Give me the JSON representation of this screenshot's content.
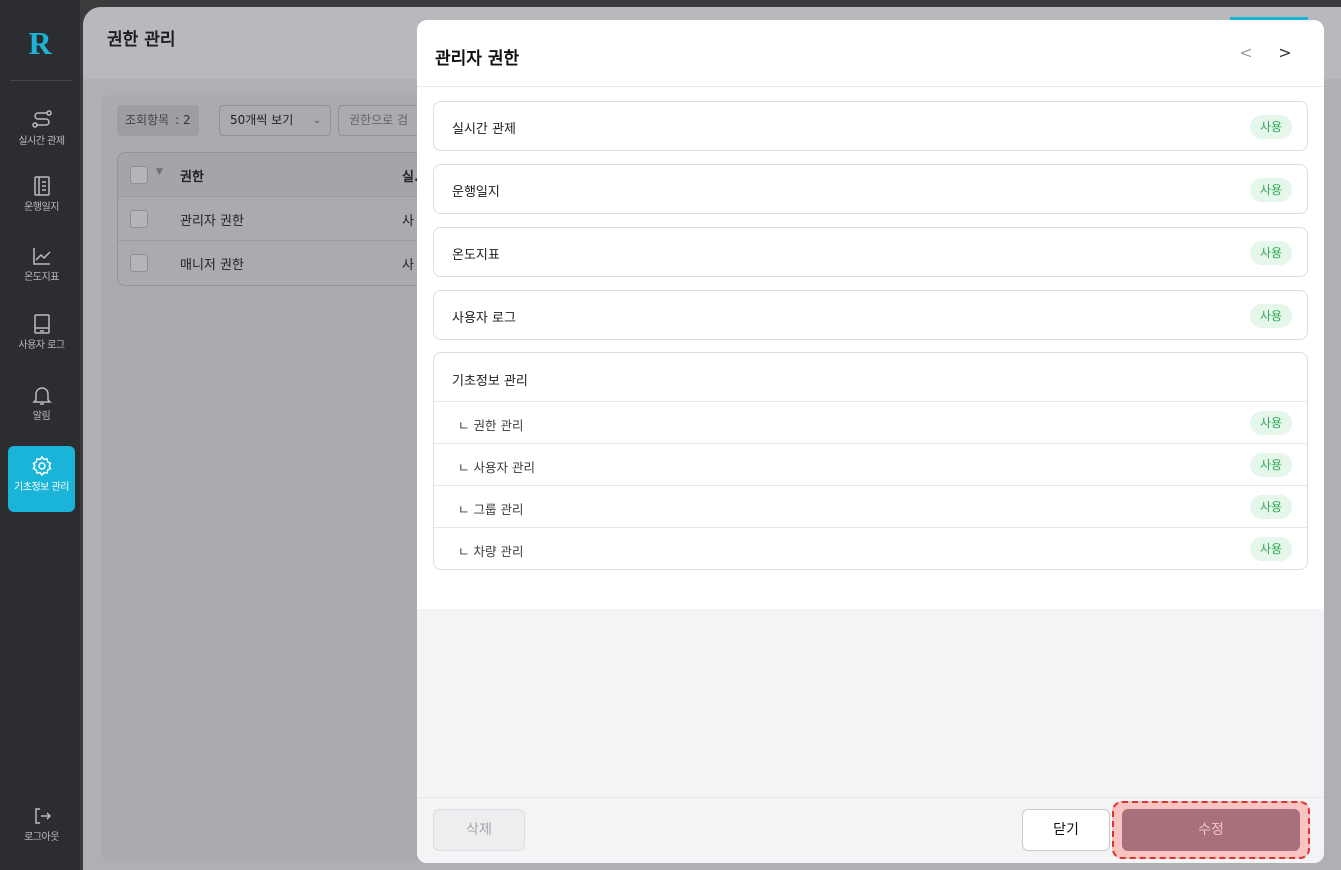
{
  "app": {
    "logo_text": "R",
    "accent_color": "#19b4d8"
  },
  "sidebar": {
    "items": [
      {
        "label": "실시간 관제",
        "icon": "route-icon"
      },
      {
        "label": "운행일지",
        "icon": "document-icon"
      },
      {
        "label": "온도지표",
        "icon": "line-chart-icon"
      },
      {
        "label": "사용자 로그",
        "icon": "monitor-icon"
      },
      {
        "label": "알림",
        "icon": "bell-icon"
      },
      {
        "label": "기초정보 관리",
        "icon": "gear-icon",
        "active": true
      }
    ],
    "logout_label": "로그아웃"
  },
  "page": {
    "title": "권한 관리",
    "count_label": "조회항목",
    "count_value": ": 2",
    "page_size": "50개씩 보기",
    "search_placeholder": "권한으로 검",
    "table": {
      "headers": [
        "권한",
        "실."
      ],
      "rows": [
        {
          "name": "관리자 권한",
          "col2": "사"
        },
        {
          "name": "매니저 권한",
          "col2": "사"
        }
      ]
    }
  },
  "modal": {
    "title": "관리자 권한",
    "prev_icon": "<",
    "next_icon": ">",
    "permissions": [
      {
        "label": "실시간 관제",
        "status": "사용"
      },
      {
        "label": "운행일지",
        "status": "사용"
      },
      {
        "label": "온도지표",
        "status": "사용"
      },
      {
        "label": "사용자 로그",
        "status": "사용"
      }
    ],
    "group": {
      "label": "기초정보 관리",
      "children": [
        {
          "label": "ㄴ 권한 관리",
          "status": "사용"
        },
        {
          "label": "ㄴ 사용자 관리",
          "status": "사용"
        },
        {
          "label": "ㄴ 그룹 관리",
          "status": "사용"
        },
        {
          "label": "ㄴ 차량 관리",
          "status": "사용"
        }
      ]
    },
    "footer": {
      "delete_label": "삭제",
      "close_label": "닫기",
      "edit_label": "수정"
    },
    "status_color": "#33a85b",
    "highlight_color": "#e0332f"
  }
}
